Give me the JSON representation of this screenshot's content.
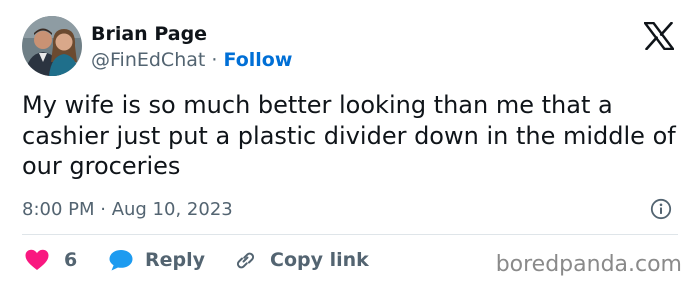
{
  "author": {
    "name": "Brian Page",
    "handle": "@FinEdChat",
    "separator": "·",
    "follow_label": "Follow"
  },
  "tweet": {
    "text": "My wife is so much better looking than me that a cashier just put a plastic divider down in the middle of our groceries",
    "timestamp": "8:00 PM · Aug 10, 2023"
  },
  "actions": {
    "like_count": "6",
    "reply_label": "Reply",
    "copy_link_label": "Copy link"
  },
  "watermark": "boredpanda.com",
  "icons": {
    "logo": "x-logo-icon",
    "info": "info-icon",
    "like": "heart-icon",
    "reply": "speech-bubble-icon",
    "link": "link-icon"
  },
  "colors": {
    "follow": "#006fd6",
    "heart": "#f91880",
    "reply_bubble": "#1d9bf0",
    "secondary_text": "#536471",
    "primary_text": "#0f1419"
  }
}
